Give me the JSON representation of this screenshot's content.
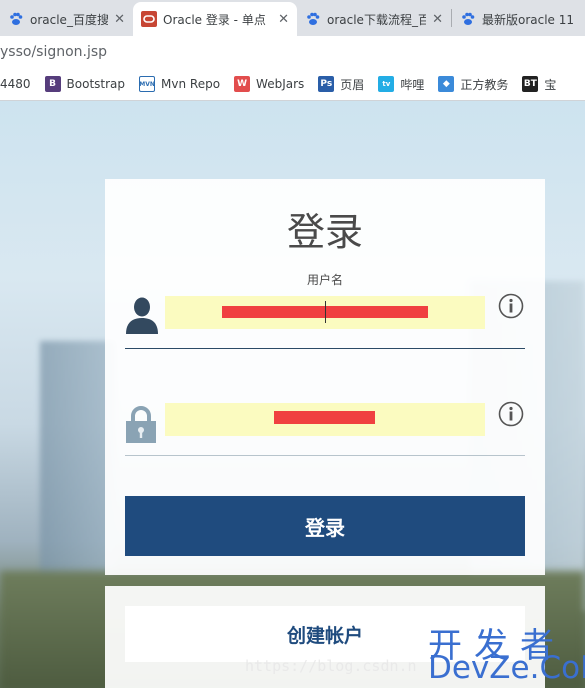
{
  "browser": {
    "tabs": [
      {
        "title": "oracle_百度搜索",
        "icon": "baidu-paw-icon",
        "close": "✕"
      },
      {
        "title": "Oracle 登录 - 单点",
        "icon": "oracle-icon",
        "close": "✕"
      },
      {
        "title": "oracle下载流程_百",
        "icon": "baidu-paw-icon",
        "close": "✕"
      },
      {
        "title": "最新版oracle 11",
        "icon": "baidu-paw-icon",
        "close": ""
      }
    ],
    "url": "ysso/signon.jsp",
    "bookmarks": [
      {
        "label": "4480",
        "icon": "",
        "color": ""
      },
      {
        "label": "Bootstrap",
        "icon": "B",
        "color": "#563d7c"
      },
      {
        "label": "Mvn Repo",
        "icon": "MVN",
        "color": "#2b6cb0"
      },
      {
        "label": "WebJars",
        "icon": "W",
        "color": "#e24d4d"
      },
      {
        "label": "页眉",
        "icon": "Ps",
        "color": "#2a5ea8"
      },
      {
        "label": "哔哩",
        "icon": "tv",
        "color": "#23ade5"
      },
      {
        "label": "正方教务",
        "icon": "◆",
        "color": "#3b8ad9"
      },
      {
        "label": "宝",
        "icon": "BT",
        "color": "#222222"
      }
    ]
  },
  "login": {
    "heading": "登录",
    "username_label": "用户名",
    "submit_label": "登录",
    "create_account_label": "创建帐户"
  },
  "watermark": {
    "url": "https://blog.csdn.n",
    "cn": "开发者",
    "en": "DevZe.CoM"
  },
  "colors": {
    "primary": "#1f4b7e",
    "field_bg": "#fbfbc0",
    "redaction": "#f04040"
  }
}
